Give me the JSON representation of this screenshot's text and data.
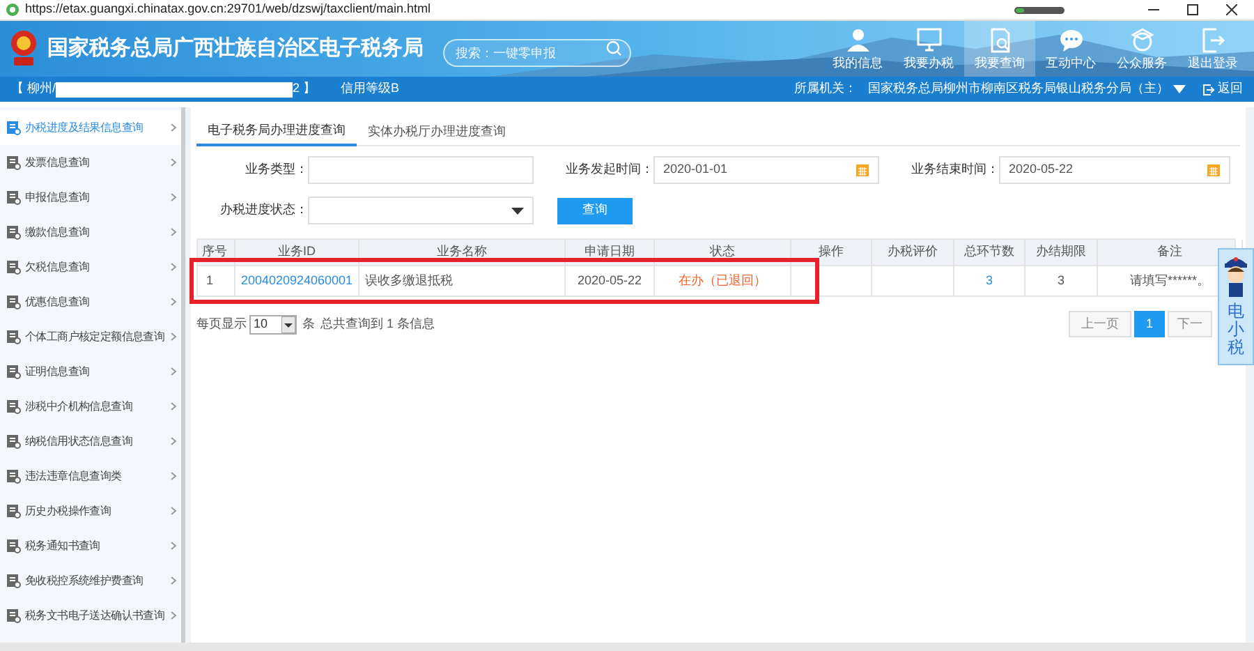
{
  "browser": {
    "url": "https://etax.guangxi.chinatax.gov.cn:29701/web/dzswj/taxclient/main.html"
  },
  "header": {
    "title": "国家税务总局广西壮族自治区电子税务局",
    "search": {
      "placeholder": "搜索：一键零申报"
    },
    "nav": [
      {
        "label": "我的信息",
        "kind": "person",
        "selected": false
      },
      {
        "label": "我要办税",
        "kind": "monitor",
        "selected": false
      },
      {
        "label": "我要查询",
        "kind": "search-doc",
        "selected": true
      },
      {
        "label": "互动中心",
        "kind": "chat",
        "selected": false
      },
      {
        "label": "公众服务",
        "kind": "service",
        "selected": false
      },
      {
        "label": "退出登录",
        "kind": "logout",
        "selected": false
      }
    ]
  },
  "info_bar": {
    "account_prefix": "【 柳州/",
    "account_suffix": "2 】",
    "credit": "信用等级B",
    "office_label": "所属机关：",
    "office": "国家税务总局柳州市柳南区税务局银山税务分局（主）",
    "back": "返回"
  },
  "sidebar": {
    "items": [
      {
        "label": "办税进度及结果信息查询",
        "selected": true
      },
      {
        "label": "发票信息查询",
        "selected": false
      },
      {
        "label": "申报信息查询",
        "selected": false
      },
      {
        "label": "缴款信息查询",
        "selected": false
      },
      {
        "label": "欠税信息查询",
        "selected": false
      },
      {
        "label": "优惠信息查询",
        "selected": false
      },
      {
        "label": "个体工商户核定定额信息查询",
        "selected": false
      },
      {
        "label": "证明信息查询",
        "selected": false
      },
      {
        "label": "涉税中介机构信息查询",
        "selected": false
      },
      {
        "label": "纳税信用状态信息查询",
        "selected": false
      },
      {
        "label": "违法违章信息查询类",
        "selected": false
      },
      {
        "label": "历史办税操作查询",
        "selected": false
      },
      {
        "label": "税务通知书查询",
        "selected": false
      },
      {
        "label": "免收税控系统维护费查询",
        "selected": false
      },
      {
        "label": "税务文书电子送达确认书查询",
        "selected": false
      }
    ]
  },
  "tabs": [
    {
      "label": "电子税务局办理进度查询",
      "selected": true
    },
    {
      "label": "实体办税厅办理进度查询",
      "selected": false
    }
  ],
  "form": {
    "fields": [
      {
        "label": "业务类型：",
        "kind": "text"
      },
      {
        "label": "业务发起时间：",
        "kind": "date",
        "value": "2020-01-01"
      },
      {
        "label": "业务结束时间：",
        "kind": "date",
        "value": "2020-05-22"
      },
      {
        "label": "办税进度状态：",
        "kind": "select"
      }
    ],
    "query_button": "查询"
  },
  "table": {
    "columns": [
      "序号",
      "业务ID",
      "业务名称",
      "申请日期",
      "状态",
      "操作",
      "办税评价",
      "总环节数",
      "办结期限",
      "备注"
    ],
    "rows": [
      {
        "no": "1",
        "id": "2004020924060001",
        "name": "误收多缴退抵税",
        "date": "2020-05-22",
        "status": "在办（已退回）",
        "steps": "3",
        "deadline": "3",
        "note": "请填写******。",
        "highlighted": true
      }
    ]
  },
  "pagination": {
    "per_page_label": "每页显示",
    "page_size": "10",
    "unit": "条",
    "total": "总共查询到 1 条信息",
    "prev": "上一页",
    "pages": [
      {
        "label": "1",
        "selected": true
      }
    ],
    "next": "下一"
  },
  "mascot": {
    "label": "电小税"
  }
}
